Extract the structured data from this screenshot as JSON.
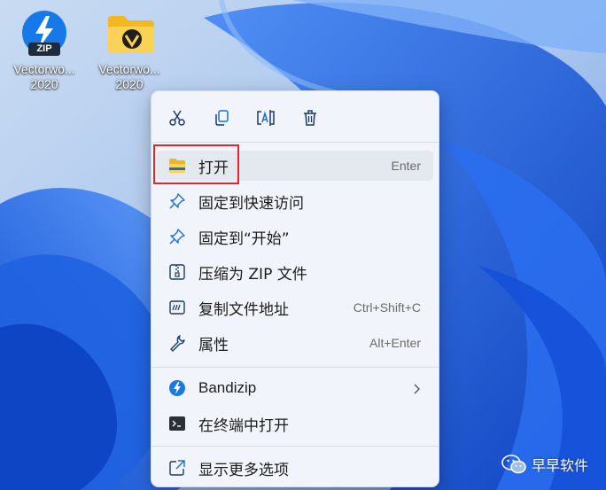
{
  "desktop": {
    "icons": [
      {
        "label_line1": "Vectorwo...",
        "label_line2": "2020",
        "icon": "bandizip-zip-icon"
      },
      {
        "label_line1": "Vectorwo...",
        "label_line2": "2020",
        "icon": "folder-icon"
      }
    ],
    "zip_badge_text": "ZIP"
  },
  "context_menu": {
    "toolbar": [
      {
        "icon": "cut-icon",
        "label": "剪切"
      },
      {
        "icon": "copy-icon",
        "label": "复制"
      },
      {
        "icon": "rename-icon",
        "label": "重命名"
      },
      {
        "icon": "delete-icon",
        "label": "删除"
      }
    ],
    "items": [
      {
        "label": "打开",
        "shortcut": "Enter",
        "icon": "folder-icon",
        "highlighted": true
      },
      {
        "label": "固定到快速访问",
        "shortcut": "",
        "icon": "pin-icon"
      },
      {
        "label": "固定到“开始”",
        "shortcut": "",
        "icon": "pin-icon"
      },
      {
        "label": "压缩为 ZIP 文件",
        "shortcut": "",
        "icon": "zip-folder-icon"
      },
      {
        "label": "复制文件地址",
        "shortcut": "Ctrl+Shift+C",
        "icon": "copy-path-icon"
      },
      {
        "label": "属性",
        "shortcut": "Alt+Enter",
        "icon": "wrench-icon"
      },
      {
        "label": "Bandizip",
        "shortcut": "",
        "icon": "bandizip-icon",
        "submenu": true
      },
      {
        "label": "在终端中打开",
        "shortcut": "",
        "icon": "terminal-icon"
      },
      {
        "label": "显示更多选项",
        "shortcut": "",
        "icon": "external-link-icon"
      }
    ]
  },
  "watermark": {
    "text": "早早软件",
    "icon": "wechat-icon"
  },
  "colors": {
    "highlight_border": "#e3262a",
    "menu_background": "#f1f4fa",
    "accent_blue": "#0a5fd8"
  }
}
